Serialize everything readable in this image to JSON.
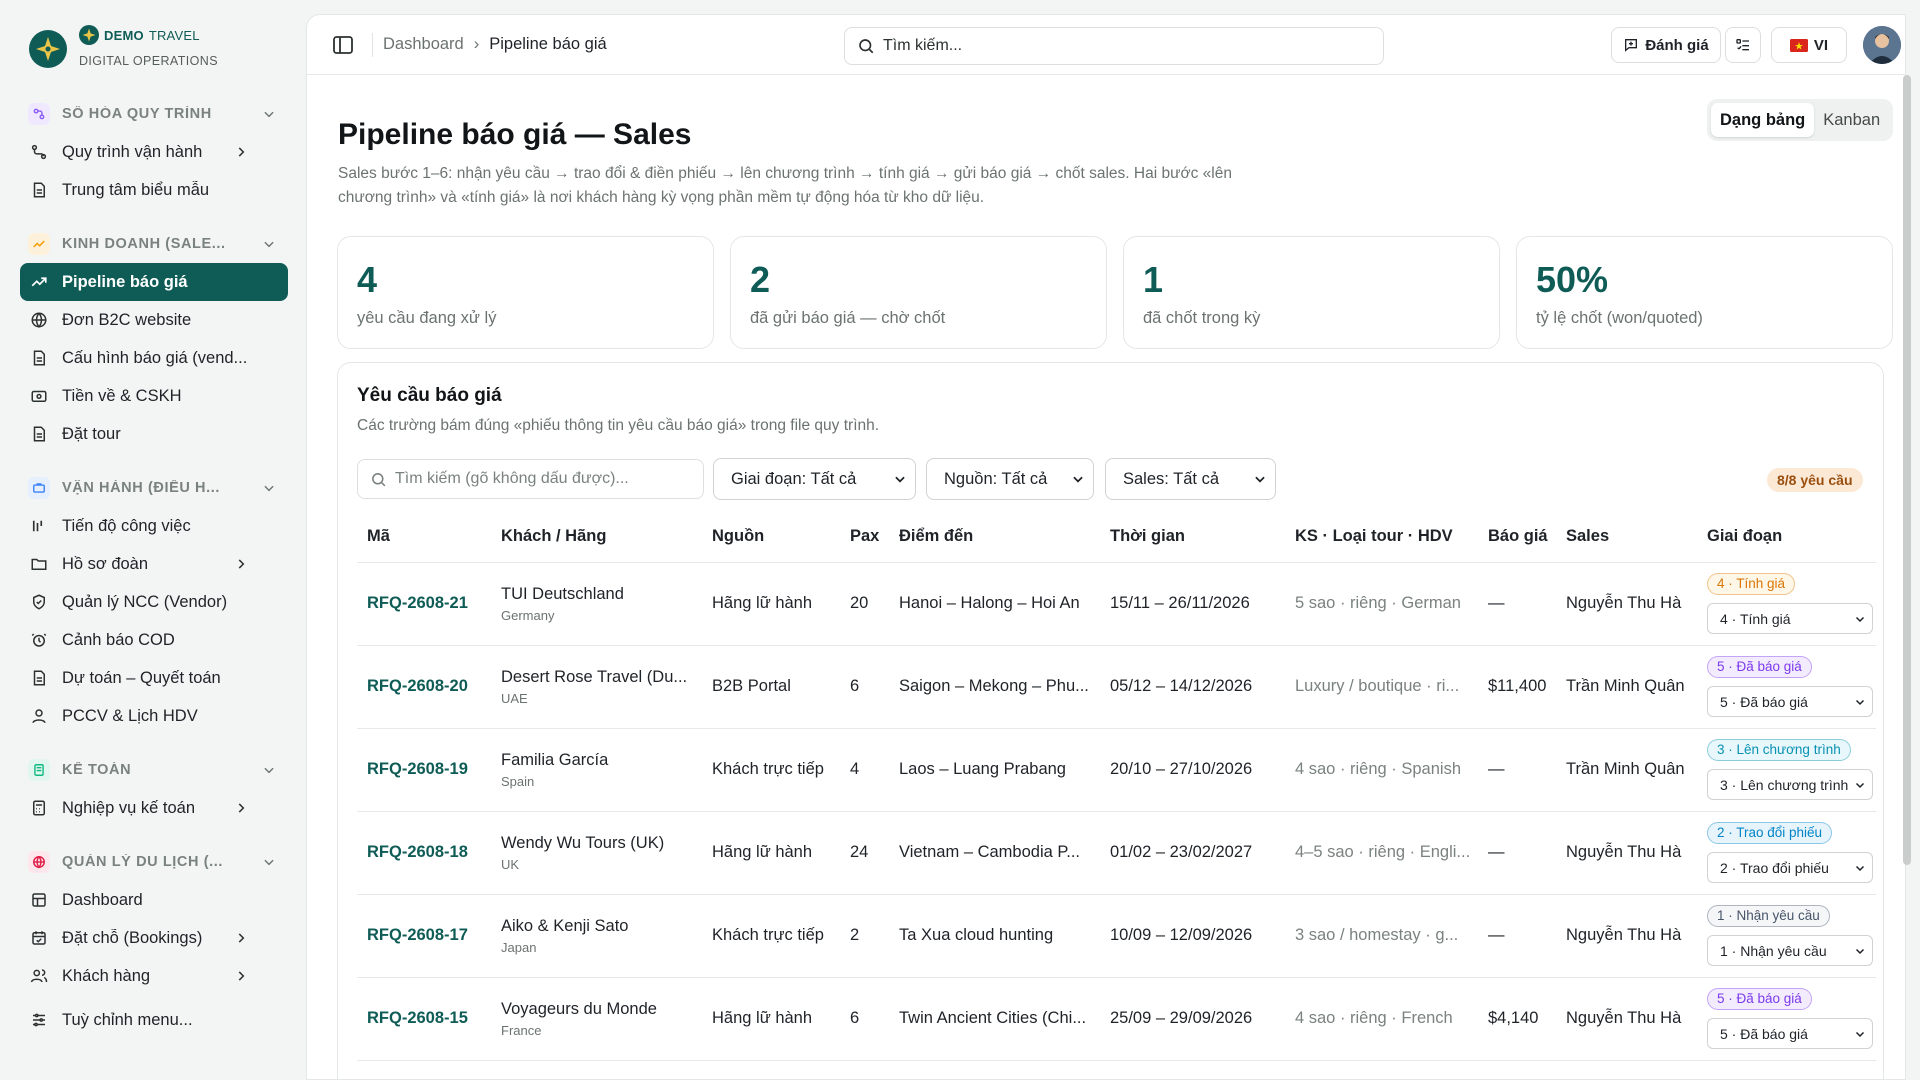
{
  "brand": {
    "name_bold": "DEMO",
    "name_light": "TRAVEL",
    "subtitle": "DIGITAL OPERATIONS"
  },
  "sidebar": {
    "sections": [
      {
        "label": "SỐ HÓA QUY TRÌNH",
        "color": "#8b5cf6",
        "items": [
          {
            "label": "Quy trình vận hành",
            "has_chevron": true
          },
          {
            "label": "Trung tâm biểu mẫu",
            "has_chevron": false
          }
        ]
      },
      {
        "label": "KINH DOANH (SALE...",
        "color": "#f59e0b",
        "items": [
          {
            "label": "Pipeline báo giá",
            "active": true
          },
          {
            "label": "Đơn B2C website"
          },
          {
            "label": "Cấu hình báo giá (vend..."
          },
          {
            "label": "Tiền về & CSKH"
          },
          {
            "label": "Đặt tour"
          }
        ]
      },
      {
        "label": "VẬN HÀNH (ĐIỀU H...",
        "color": "#3b82f6",
        "items": [
          {
            "label": "Tiến độ công việc"
          },
          {
            "label": "Hồ sơ đoàn",
            "has_chevron": true
          },
          {
            "label": "Quản lý NCC (Vendor)"
          },
          {
            "label": "Cảnh báo COD"
          },
          {
            "label": "Dự toán – Quyết toán"
          },
          {
            "label": "PCCV & Lịch HDV"
          }
        ]
      },
      {
        "label": "KẾ TOÁN",
        "color": "#10b981",
        "items": [
          {
            "label": "Nghiệp vụ kế toán",
            "has_chevron": true
          }
        ]
      },
      {
        "label": "QUẢN LÝ DU LỊCH (...",
        "color": "#e11d48",
        "items": [
          {
            "label": "Dashboard"
          },
          {
            "label": "Đặt chỗ (Bookings)",
            "has_chevron": true
          },
          {
            "label": "Khách hàng",
            "has_chevron": true
          }
        ]
      }
    ],
    "customize": "Tuỳ chỉnh menu..."
  },
  "topbar": {
    "breadcrumb": [
      "Dashboard",
      "Pipeline báo giá"
    ],
    "search_placeholder": "Tìm kiếm...",
    "feedback_label": "Đánh giá",
    "lang_label": "VI"
  },
  "page": {
    "title": "Pipeline báo giá — Sales",
    "description": "Sales bước 1–6: nhận yêu cầu → trao đổi & điền phiếu → lên chương trình → tính giá → gửi báo giá → chốt sales. Hai bước «lên chương trình» và «tính giá» là nơi khách hàng kỳ vọng phần mềm tự động hóa từ kho dữ liệu.",
    "view_modes": [
      "Dạng bảng",
      "Kanban"
    ],
    "active_view": "Dạng bảng"
  },
  "stats": [
    {
      "value": "4",
      "label": "yêu cầu đang xử lý"
    },
    {
      "value": "2",
      "label": "đã gửi báo giá — chờ chốt"
    },
    {
      "value": "1",
      "label": "đã chốt trong kỳ"
    },
    {
      "value": "50%",
      "label": "tỷ lệ chốt (won/quoted)"
    }
  ],
  "requests": {
    "title": "Yêu cầu báo giá",
    "subtitle": "Các trường bám đúng «phiếu thông tin yêu cầu báo giá» trong file quy trình.",
    "search_placeholder": "Tìm kiếm (gõ không dấu được)...",
    "filters": {
      "stage": "Giai đoạn: Tất cả",
      "source": "Nguồn: Tất cả",
      "sales": "Sales: Tất cả"
    },
    "count_badge": "8/8 yêu cầu",
    "columns": [
      "Mã",
      "Khách / Hãng",
      "Nguồn",
      "Pax",
      "Điểm đến",
      "Thời gian",
      "KS · Loại tour · HDV",
      "Báo giá",
      "Sales",
      "Giai đoạn"
    ],
    "rows": [
      {
        "code": "RFQ-2608-21",
        "client": "TUI Deutschland",
        "country": "Germany",
        "source": "Hãng lữ hành",
        "pax": "20",
        "destination": "Hanoi – Halong – Hoi An",
        "dates": "15/11 – 26/11/2026",
        "service": "5 sao · riêng · German",
        "quote": "—",
        "sales": "Nguyễn Thu Hà",
        "stage": "4 · Tính giá",
        "stage_color": "#d97706",
        "stage_bg": "#fef6e7"
      },
      {
        "code": "RFQ-2608-20",
        "client": "Desert Rose Travel (Du...",
        "country": "UAE",
        "source": "B2B Portal",
        "pax": "6",
        "destination": "Saigon – Mekong – Phu...",
        "dates": "05/12 – 14/12/2026",
        "service": "Luxury / boutique · ri...",
        "quote": "$11,400",
        "sales": "Trần Minh Quân",
        "stage": "5 · Đã báo giá",
        "stage_color": "#7c3aed",
        "stage_bg": "#f3ecfe"
      },
      {
        "code": "RFQ-2608-19",
        "client": "Familia García",
        "country": "Spain",
        "source": "Khách trực tiếp",
        "pax": "4",
        "destination": "Laos – Luang Prabang",
        "dates": "20/10 – 27/10/2026",
        "service": "4 sao · riêng · Spanish",
        "quote": "—",
        "sales": "Trần Minh Quân",
        "stage": "3 · Lên chương trình",
        "stage_color": "#0891b2",
        "stage_bg": "#e7f7fb"
      },
      {
        "code": "RFQ-2608-18",
        "client": "Wendy Wu Tours (UK)",
        "country": "UK",
        "source": "Hãng lữ hành",
        "pax": "24",
        "destination": "Vietnam – Cambodia P...",
        "dates": "01/02 – 23/02/2027",
        "service": "4–5 sao · riêng · Engli...",
        "quote": "—",
        "sales": "Nguyễn Thu Hà",
        "stage": "2 · Trao đổi phiếu",
        "stage_color": "#0284c7",
        "stage_bg": "#e8f4fc"
      },
      {
        "code": "RFQ-2608-17",
        "client": "Aiko & Kenji Sato",
        "country": "Japan",
        "source": "Khách trực tiếp",
        "pax": "2",
        "destination": "Ta Xua cloud hunting",
        "dates": "10/09 – 12/09/2026",
        "service": "3 sao / homestay · g...",
        "quote": "—",
        "sales": "Nguyễn Thu Hà",
        "stage": "1 · Nhận yêu cầu",
        "stage_color": "#475569",
        "stage_bg": "#f4f6f8"
      },
      {
        "code": "RFQ-2608-15",
        "client": "Voyageurs du Monde",
        "country": "France",
        "source": "Hãng lữ hành",
        "pax": "6",
        "destination": "Twin Ancient Cities (Chi...",
        "dates": "25/09 – 29/09/2026",
        "service": "4 sao · riêng · French",
        "quote": "$4,140",
        "sales": "Nguyễn Thu Hà",
        "stage": "5 · Đã báo giá",
        "stage_color": "#7c3aed",
        "stage_bg": "#f3ecfe"
      }
    ]
  }
}
